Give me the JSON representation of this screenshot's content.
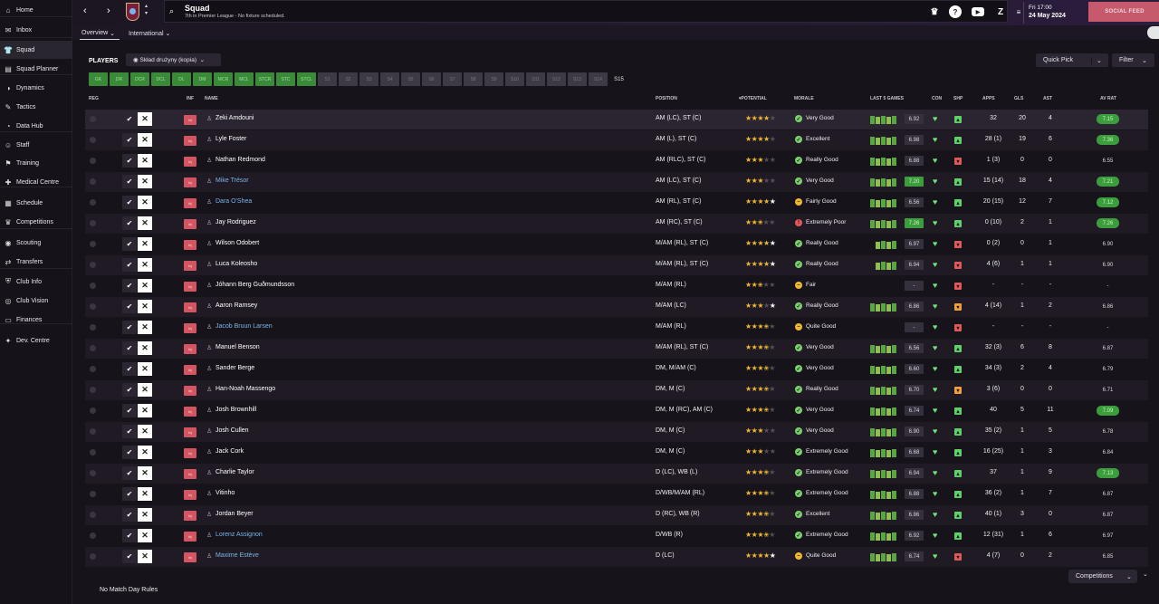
{
  "sidebar": {
    "items": [
      {
        "label": "Home",
        "icon": "home-icon",
        "glyph": "⌂",
        "active": false
      },
      {
        "label": "Inbox",
        "icon": "inbox-icon",
        "glyph": "✉",
        "active": false
      },
      {
        "label": "Squad",
        "icon": "squad-icon",
        "glyph": "👕",
        "active": true
      },
      {
        "label": "Squad Planner",
        "icon": "squad-planner-icon",
        "glyph": "▤",
        "active": false
      },
      {
        "label": "Dynamics",
        "icon": "dynamics-icon",
        "glyph": "◑",
        "active": false
      },
      {
        "label": "Tactics",
        "icon": "tactics-icon",
        "glyph": "✎",
        "active": false
      },
      {
        "label": "Data Hub",
        "icon": "data-hub-icon",
        "glyph": "◔",
        "active": false
      },
      {
        "label": "Staff",
        "icon": "staff-icon",
        "glyph": "☺",
        "active": false
      },
      {
        "label": "Training",
        "icon": "training-icon",
        "glyph": "⚑",
        "active": false
      },
      {
        "label": "Medical Centre",
        "icon": "medical-icon",
        "glyph": "✚",
        "active": false
      },
      {
        "label": "Schedule",
        "icon": "schedule-icon",
        "glyph": "▦",
        "active": false
      },
      {
        "label": "Competitions",
        "icon": "trophy-icon",
        "glyph": "♛",
        "active": false
      },
      {
        "label": "Scouting",
        "icon": "scouting-icon",
        "glyph": "◉",
        "active": false
      },
      {
        "label": "Transfers",
        "icon": "transfers-icon",
        "glyph": "⇄",
        "active": false
      },
      {
        "label": "Club Info",
        "icon": "club-info-icon",
        "glyph": "⛨",
        "active": false
      },
      {
        "label": "Club Vision",
        "icon": "club-vision-icon",
        "glyph": "◎",
        "active": false
      },
      {
        "label": "Finances",
        "icon": "finances-icon",
        "glyph": "▭",
        "active": false
      },
      {
        "label": "Dev. Centre",
        "icon": "dev-centre-icon",
        "glyph": "✦",
        "active": false
      }
    ]
  },
  "topbar": {
    "title": "Squad",
    "subtitle": "7th in Premier League - No fixture scheduled.",
    "date_day": "Fri 17:00",
    "date_full": "24 May 2024",
    "social_feed": "SOCIAL FEED"
  },
  "subnav": {
    "tab_overview": "Overview",
    "tab_international": "International"
  },
  "toolbar": {
    "players_label": "PLAYERS",
    "view_select": "Skład drużyny (kopia)",
    "quick_pick": "Quick Pick",
    "filter": "Filter"
  },
  "pos_filters": [
    {
      "label": "GK",
      "on": true
    },
    {
      "label": "DR",
      "on": true
    },
    {
      "label": "DCR",
      "on": true
    },
    {
      "label": "DCL",
      "on": true
    },
    {
      "label": "DL",
      "on": true
    },
    {
      "label": "DM",
      "on": true
    },
    {
      "label": "MCR",
      "on": true
    },
    {
      "label": "MCL",
      "on": true
    },
    {
      "label": "STCR",
      "on": true
    },
    {
      "label": "STC",
      "on": true
    },
    {
      "label": "STCL",
      "on": true
    },
    {
      "label": "S1",
      "on": false
    },
    {
      "label": "S2",
      "on": false
    },
    {
      "label": "S3",
      "on": false
    },
    {
      "label": "S4",
      "on": false
    },
    {
      "label": "S5",
      "on": false
    },
    {
      "label": "S6",
      "on": false
    },
    {
      "label": "S7",
      "on": false
    },
    {
      "label": "S8",
      "on": false
    },
    {
      "label": "S9",
      "on": false
    },
    {
      "label": "S10",
      "on": false
    },
    {
      "label": "S11",
      "on": false
    },
    {
      "label": "S12",
      "on": false
    },
    {
      "label": "S13",
      "on": false
    },
    {
      "label": "S14",
      "on": false
    },
    {
      "label": "S15",
      "on": null
    }
  ],
  "headers": {
    "reg": "REG",
    "inf": "INF",
    "name": "NAME",
    "position": "POSITION",
    "potential": "POTENTIAL",
    "morale": "MORALE",
    "last5": "LAST 5 GAMES",
    "con": "CON",
    "shp": "SHP",
    "apps": "APPS",
    "gls": "GLS",
    "ast": "AST",
    "avrat": "AV RAT"
  },
  "players": [
    {
      "name": "Zeki Amdouni",
      "link": false,
      "inf": "Int",
      "pos": "AM (LC), ST (C)",
      "stars": 4,
      "white": 0,
      "morale": "Very Good",
      "mc": "#7ad06c",
      "mg": "✓",
      "form": "6.92",
      "formhi": false,
      "bars": [
        1,
        1,
        1,
        1,
        1
      ],
      "shp": "#5fd06a",
      "shpg": "▴",
      "apps": "32",
      "gls": "20",
      "ast": "4",
      "avrat": "7.15",
      "avhi": true
    },
    {
      "name": "Lyle Foster",
      "link": false,
      "inf": "Inj",
      "pos": "AM (L), ST (C)",
      "stars": 4,
      "white": 0,
      "morale": "Excellent",
      "mc": "#7ad06c",
      "mg": "✓",
      "form": "6.98",
      "formhi": false,
      "bars": [
        1,
        1,
        1,
        1,
        1
      ],
      "shp": "#5fd06a",
      "shpg": "▴",
      "apps": "28 (1)",
      "gls": "19",
      "ast": "6",
      "avrat": "7.36",
      "avhi": true
    },
    {
      "name": "Nathan Redmond",
      "link": false,
      "inf": "Inj",
      "pos": "AM (RLC), ST (C)",
      "stars": 3,
      "white": 0,
      "morale": "Really Good",
      "mc": "#7ad06c",
      "mg": "✓",
      "form": "6.88",
      "formhi": false,
      "bars": [
        1,
        1,
        1,
        1,
        1
      ],
      "shp": "#e05a5a",
      "shpg": "▾",
      "apps": "1 (3)",
      "gls": "0",
      "ast": "0",
      "avrat": "6.55",
      "avhi": false
    },
    {
      "name": "Mike Trésor",
      "link": true,
      "inf": "Inj",
      "pos": "AM (LC), ST (C)",
      "stars": 3,
      "white": 0,
      "morale": "Very Good",
      "mc": "#7ad06c",
      "mg": "✓",
      "form": "7.20",
      "formhi": true,
      "bars": [
        1,
        1,
        1,
        1,
        1
      ],
      "shp": "#5fd06a",
      "shpg": "▴",
      "apps": "15 (14)",
      "gls": "18",
      "ast": "4",
      "avrat": "7.21",
      "avhi": true
    },
    {
      "name": "Dara O'Shea",
      "link": true,
      "inf": "Inj",
      "pos": "AM (RL), ST (C)",
      "stars": 4,
      "white": 1,
      "morale": "Fairly Good",
      "mc": "#f0b830",
      "mg": "–",
      "form": "6.56",
      "formhi": false,
      "bars": [
        1,
        1,
        1,
        1,
        1
      ],
      "shp": "#5fd06a",
      "shpg": "▴",
      "apps": "20 (15)",
      "gls": "12",
      "ast": "7",
      "avrat": "7.12",
      "avhi": true
    },
    {
      "name": "Jay Rodriguez",
      "link": false,
      "inf": "Inj",
      "pos": "AM (RC), ST (C)",
      "stars": 2.5,
      "white": 0,
      "morale": "Extremely Poor",
      "mc": "#e05a5a",
      "mg": "!",
      "form": "7.26",
      "formhi": true,
      "bars": [
        1,
        1,
        1,
        1,
        1
      ],
      "shp": "#5fd06a",
      "shpg": "▴",
      "apps": "0 (10)",
      "gls": "2",
      "ast": "1",
      "avrat": "7.26",
      "avhi": true
    },
    {
      "name": "Wilson Odobert",
      "link": false,
      "inf": "Inj",
      "pos": "M/AM (RL), ST (C)",
      "stars": 4,
      "white": 1,
      "morale": "Really Good",
      "mc": "#7ad06c",
      "mg": "✓",
      "form": "6.97",
      "formhi": false,
      "bars": [
        0,
        1,
        1,
        1,
        1
      ],
      "shp": "#e05a5a",
      "shpg": "▾",
      "apps": "0 (2)",
      "gls": "0",
      "ast": "1",
      "avrat": "6.90",
      "avhi": false
    },
    {
      "name": "Luca Koleosho",
      "link": false,
      "inf": "Inj",
      "pos": "M/AM (RL), ST (C)",
      "stars": 4,
      "white": 1,
      "morale": "Really Good",
      "mc": "#7ad06c",
      "mg": "✓",
      "form": "6.94",
      "formhi": false,
      "bars": [
        0,
        1,
        1,
        1,
        1
      ],
      "shp": "#e05a5a",
      "shpg": "▾",
      "apps": "4 (6)",
      "gls": "1",
      "ast": "1",
      "avrat": "6.90",
      "avhi": false
    },
    {
      "name": "Jóhann Berg Guðmundsson",
      "link": false,
      "inf": "Inj",
      "pos": "M/AM (RL)",
      "stars": 2.5,
      "white": 0,
      "morale": "Fair",
      "mc": "#f0b830",
      "mg": "–",
      "form": "-",
      "formhi": false,
      "bars": [
        0,
        0,
        0,
        0,
        0
      ],
      "shp": "#e05a5a",
      "shpg": "▾",
      "apps": "-",
      "gls": "-",
      "ast": "-",
      "avrat": "-",
      "avhi": false
    },
    {
      "name": "Aaron Ramsey",
      "link": false,
      "inf": "Inj",
      "pos": "M/AM (LC)",
      "stars": 3,
      "white": 1,
      "morale": "Really Good",
      "mc": "#7ad06c",
      "mg": "✓",
      "form": "6.86",
      "formhi": false,
      "bars": [
        1,
        1,
        1,
        1,
        1
      ],
      "shp": "#f0a040",
      "shpg": "▾",
      "apps": "4 (14)",
      "gls": "1",
      "ast": "2",
      "avrat": "6.86",
      "avhi": false
    },
    {
      "name": "Jacob Bruun Larsen",
      "link": true,
      "inf": "Inj",
      "pos": "M/AM (RL)",
      "stars": 3.5,
      "white": 0,
      "morale": "Quite Good",
      "mc": "#f0b830",
      "mg": "–",
      "form": "-",
      "formhi": false,
      "bars": [
        0,
        0,
        0,
        0,
        0
      ],
      "shp": "#e05a5a",
      "shpg": "▾",
      "apps": "-",
      "gls": "-",
      "ast": "-",
      "avrat": "-",
      "avhi": false
    },
    {
      "name": "Manuel Benson",
      "link": false,
      "inf": "Inj",
      "pos": "M/AM (RL), ST (C)",
      "stars": 3.5,
      "white": 0,
      "morale": "Very Good",
      "mc": "#7ad06c",
      "mg": "✓",
      "form": "6.56",
      "formhi": false,
      "bars": [
        1,
        1,
        1,
        1,
        1
      ],
      "shp": "#5fd06a",
      "shpg": "▴",
      "apps": "32 (3)",
      "gls": "6",
      "ast": "8",
      "avrat": "6.87",
      "avhi": false
    },
    {
      "name": "Sander Berge",
      "link": false,
      "inf": "Inj",
      "pos": "DM, M/AM (C)",
      "stars": 3.5,
      "white": 0,
      "morale": "Very Good",
      "mc": "#7ad06c",
      "mg": "✓",
      "form": "6.60",
      "formhi": false,
      "bars": [
        1,
        1,
        1,
        1,
        1
      ],
      "shp": "#5fd06a",
      "shpg": "▴",
      "apps": "34 (3)",
      "gls": "2",
      "ast": "4",
      "avrat": "6.79",
      "avhi": false
    },
    {
      "name": "Han-Noah Massengo",
      "link": false,
      "inf": "Inj",
      "pos": "DM, M (C)",
      "stars": 3.5,
      "white": 0,
      "morale": "Really Good",
      "mc": "#7ad06c",
      "mg": "✓",
      "form": "6.70",
      "formhi": false,
      "bars": [
        1,
        1,
        1,
        1,
        1
      ],
      "shp": "#f0a040",
      "shpg": "▾",
      "apps": "3 (6)",
      "gls": "0",
      "ast": "0",
      "avrat": "6.71",
      "avhi": false
    },
    {
      "name": "Josh Brownhill",
      "link": false,
      "inf": "Inj",
      "pos": "DM, M (RC), AM (C)",
      "stars": 3.5,
      "white": 0,
      "morale": "Very Good",
      "mc": "#7ad06c",
      "mg": "✓",
      "form": "6.74",
      "formhi": false,
      "bars": [
        1,
        1,
        1,
        1,
        1
      ],
      "shp": "#5fd06a",
      "shpg": "▴",
      "apps": "40",
      "gls": "5",
      "ast": "11",
      "avrat": "7.09",
      "avhi": true
    },
    {
      "name": "Josh Cullen",
      "link": false,
      "inf": "Inj",
      "pos": "DM, M (C)",
      "stars": 3,
      "white": 0,
      "morale": "Very Good",
      "mc": "#7ad06c",
      "mg": "✓",
      "form": "6.90",
      "formhi": false,
      "bars": [
        1,
        1,
        1,
        1,
        1
      ],
      "shp": "#5fd06a",
      "shpg": "▴",
      "apps": "35 (2)",
      "gls": "1",
      "ast": "5",
      "avrat": "6.78",
      "avhi": false
    },
    {
      "name": "Jack Cork",
      "link": false,
      "inf": "Inj",
      "pos": "DM, M (C)",
      "stars": 3,
      "white": 0,
      "morale": "Extremely Good",
      "mc": "#7ad06c",
      "mg": "✓",
      "form": "6.68",
      "formhi": false,
      "bars": [
        1,
        1,
        1,
        1,
        1
      ],
      "shp": "#5fd06a",
      "shpg": "▴",
      "apps": "16 (25)",
      "gls": "1",
      "ast": "3",
      "avrat": "6.84",
      "avhi": false
    },
    {
      "name": "Charlie Taylor",
      "link": false,
      "inf": "Inj",
      "pos": "D (LC), WB (L)",
      "stars": 3.5,
      "white": 0,
      "morale": "Extremely Good",
      "mc": "#7ad06c",
      "mg": "✓",
      "form": "6.94",
      "formhi": false,
      "bars": [
        1,
        1,
        1,
        1,
        1
      ],
      "shp": "#5fd06a",
      "shpg": "▴",
      "apps": "37",
      "gls": "1",
      "ast": "9",
      "avrat": "7.13",
      "avhi": true
    },
    {
      "name": "Vitinho",
      "link": false,
      "inf": "Inj",
      "pos": "D/WB/M/AM (RL)",
      "stars": 3.5,
      "white": 0,
      "morale": "Extremely Good",
      "mc": "#7ad06c",
      "mg": "✓",
      "form": "6.88",
      "formhi": false,
      "bars": [
        1,
        1,
        1,
        1,
        1
      ],
      "shp": "#5fd06a",
      "shpg": "▴",
      "apps": "36 (2)",
      "gls": "1",
      "ast": "7",
      "avrat": "6.87",
      "avhi": false
    },
    {
      "name": "Jordan Beyer",
      "link": false,
      "inf": "Inj",
      "pos": "D (RC), WB (R)",
      "stars": 3.5,
      "white": 0,
      "morale": "Excellent",
      "mc": "#7ad06c",
      "mg": "✓",
      "form": "6.86",
      "formhi": false,
      "bars": [
        1,
        1,
        1,
        1,
        1
      ],
      "shp": "#5fd06a",
      "shpg": "▴",
      "apps": "40 (1)",
      "gls": "3",
      "ast": "0",
      "avrat": "6.87",
      "avhi": false
    },
    {
      "name": "Lorenz Assignon",
      "link": true,
      "inf": "Inj",
      "pos": "D/WB (R)",
      "stars": 3.5,
      "white": 0,
      "morale": "Extremely Good",
      "mc": "#7ad06c",
      "mg": "✓",
      "form": "6.92",
      "formhi": false,
      "bars": [
        1,
        1,
        1,
        1,
        1
      ],
      "shp": "#5fd06a",
      "shpg": "▴",
      "apps": "12 (31)",
      "gls": "1",
      "ast": "6",
      "avrat": "6.97",
      "avhi": false
    },
    {
      "name": "Maxime Estève",
      "link": true,
      "inf": "Inj",
      "pos": "D (LC)",
      "stars": 4,
      "white": 1,
      "morale": "Quite Good",
      "mc": "#f0b830",
      "mg": "–",
      "form": "6.74",
      "formhi": false,
      "bars": [
        1,
        1,
        1,
        1,
        1
      ],
      "shp": "#e05a5a",
      "shpg": "▾",
      "apps": "4 (7)",
      "gls": "0",
      "ast": "2",
      "avrat": "6.85",
      "avhi": false
    }
  ],
  "footer": {
    "rules": "No Match Day Rules",
    "competitions": "Competitions"
  }
}
